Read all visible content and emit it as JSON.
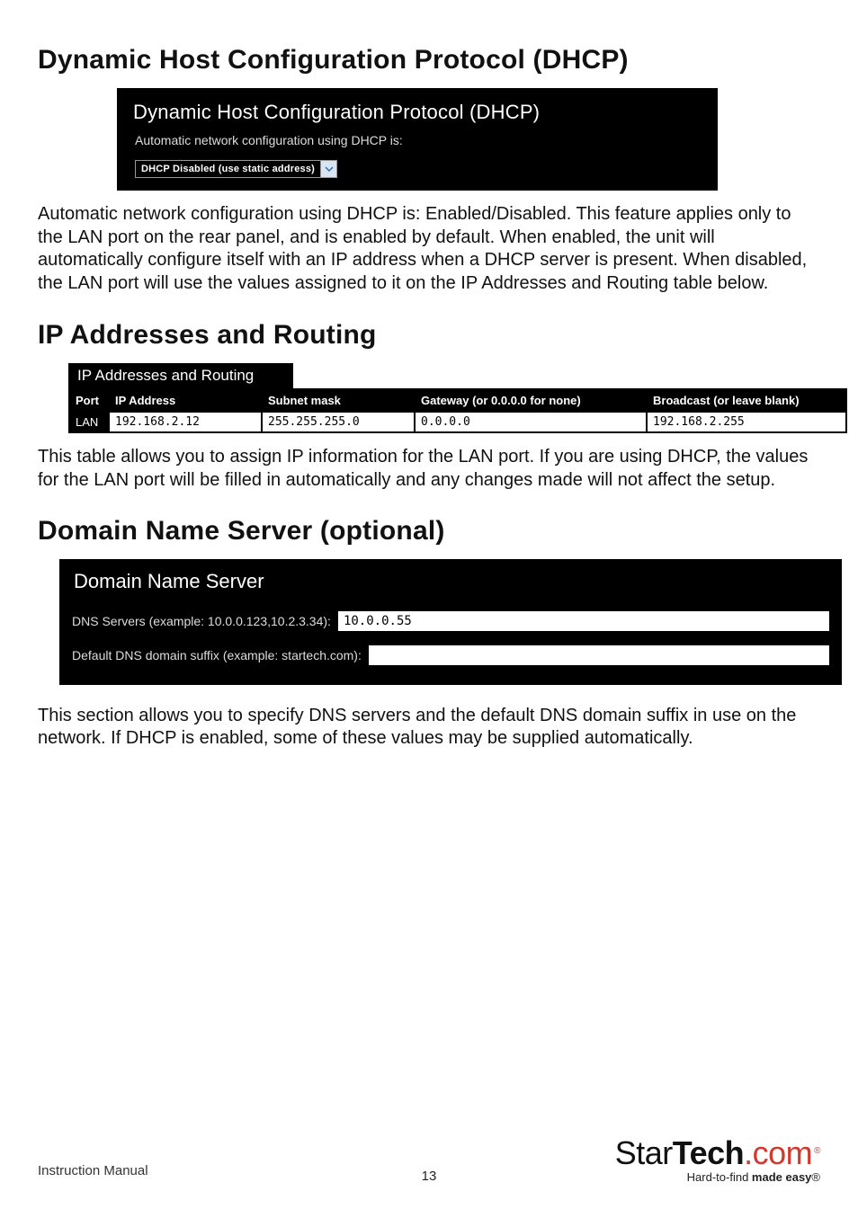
{
  "sections": {
    "dhcp": {
      "heading": "Dynamic Host Configuration Protocol (DHCP)",
      "panel_title": "Dynamic Host Configuration Protocol (DHCP)",
      "panel_sub": "Automatic network configuration using DHCP is:",
      "dropdown_value": "DHCP Disabled (use static address)",
      "body": "Automatic network configuration using DHCP is: Enabled/Disabled. This feature applies only to the LAN port on the rear panel, and is enabled by default. When enabled, the unit will automatically configure itself with an IP address when a DHCP server is present. When disabled, the LAN port will use the values assigned to it on the IP Addresses and Routing table below."
    },
    "ip": {
      "heading": "IP Addresses and Routing",
      "panel_title": "IP Addresses and Routing",
      "columns": {
        "port": "Port",
        "ip": "IP Address",
        "mask": "Subnet mask",
        "gateway": "Gateway (or 0.0.0.0 for none)",
        "broadcast": "Broadcast (or leave blank)"
      },
      "rows": [
        {
          "port": "LAN",
          "ip": "192.168.2.12",
          "mask": "255.255.255.0",
          "gateway": "0.0.0.0",
          "broadcast": "192.168.2.255"
        }
      ],
      "body": "This table allows you to assign IP information for the LAN port. If you are using DHCP, the values for the LAN port will be filled in automatically and any changes made will not affect the setup."
    },
    "dns": {
      "heading": "Domain Name Server (optional)",
      "panel_title": "Domain Name Server",
      "row1_label": "DNS Servers (example: 10.0.0.123,10.2.3.34):",
      "row1_value": "10.0.0.55",
      "row2_label": "Default DNS domain suffix (example: startech.com):",
      "row2_value": "",
      "body": "This section allows you to specify DNS servers and the default DNS domain suffix in use on the network. If DHCP is enabled, some of these values may be supplied automatically."
    }
  },
  "footer": {
    "manual": "Instruction Manual",
    "page": "13",
    "brand_a": "Star",
    "brand_b": "Tech",
    "brand_c": ".com",
    "reg": "®",
    "tagline_a": "Hard-to-find ",
    "tagline_b": "made easy",
    "tagline_c": "®"
  }
}
